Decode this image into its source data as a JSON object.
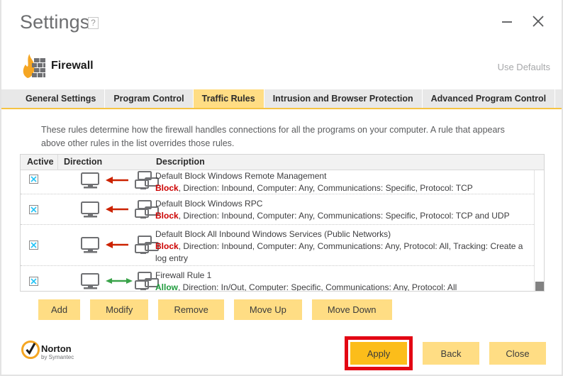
{
  "window": {
    "title": "Settings",
    "help_label": "?",
    "minimize_label": "minimize",
    "close_label": "close"
  },
  "header": {
    "section_title": "Firewall",
    "icon": "firewall-flame-wall-icon",
    "use_defaults_label": "Use Defaults"
  },
  "tabs": [
    {
      "label": "General Settings",
      "active": false
    },
    {
      "label": "Program Control",
      "active": false
    },
    {
      "label": "Traffic Rules",
      "active": true
    },
    {
      "label": "Intrusion and Browser Protection",
      "active": false
    },
    {
      "label": "Advanced Program Control",
      "active": false
    }
  ],
  "panel": {
    "intro": "These rules determine how the firewall handles connections for all the programs on your computer. A rule that appears above other rules in the list overrides those rules."
  },
  "table": {
    "columns": [
      "Active",
      "Direction",
      "Description"
    ],
    "rows": [
      {
        "active": true,
        "direction": "inbound",
        "arrow": "arrow-left-red-icon",
        "name": "Default Block Windows Remote Management",
        "verdict": "Block",
        "verdict_type": "block",
        "details": ", Direction: Inbound, Computer: Any, Communications: Specific, Protocol: TCP"
      },
      {
        "active": true,
        "direction": "inbound",
        "arrow": "arrow-left-red-icon",
        "name": "Default Block Windows RPC",
        "verdict": "Block",
        "verdict_type": "block",
        "details": ", Direction: Inbound, Computer: Any, Communications: Specific, Protocol: TCP and UDP"
      },
      {
        "active": true,
        "direction": "inbound",
        "arrow": "arrow-left-red-icon",
        "name": "Default Block All Inbound Windows Services (Public Networks)",
        "verdict": "Block",
        "verdict_type": "block",
        "details": ", Direction: Inbound, Computer: Any, Communications: Any, Protocol: All, Tracking: Create a log entry"
      },
      {
        "active": true,
        "direction": "in-out",
        "arrow": "arrow-bidirectional-green-icon",
        "name": "Firewall Rule 1",
        "verdict": "Allow",
        "verdict_type": "allow",
        "details": ", Direction: In/Out, Computer: Specific, Communications: Any, Protocol: All"
      }
    ]
  },
  "actions": [
    {
      "label": "Add"
    },
    {
      "label": "Modify"
    },
    {
      "label": "Remove"
    },
    {
      "label": "Move Up"
    },
    {
      "label": "Move Down"
    }
  ],
  "footer": {
    "brand_name": "Norton",
    "brand_sub": "by Symantec",
    "buttons": [
      {
        "label": "Apply",
        "primary": true,
        "highlighted": true
      },
      {
        "label": "Back",
        "primary": false,
        "highlighted": false
      },
      {
        "label": "Close",
        "primary": false,
        "highlighted": false
      }
    ]
  },
  "colors": {
    "accent_gold": "#ffdd84",
    "accent_gold_strong": "#fcbd1a",
    "tab_underline": "#f5c344",
    "block_red": "#cc0000",
    "allow_green": "#1f9b3d",
    "arrow_red": "#cc2200",
    "arrow_green": "#3aa34a",
    "checkbox_x": "#29c5f6",
    "highlight_box": "#e30613",
    "icon_gray": "#6f7073",
    "flame_orange": "#f5a623"
  }
}
